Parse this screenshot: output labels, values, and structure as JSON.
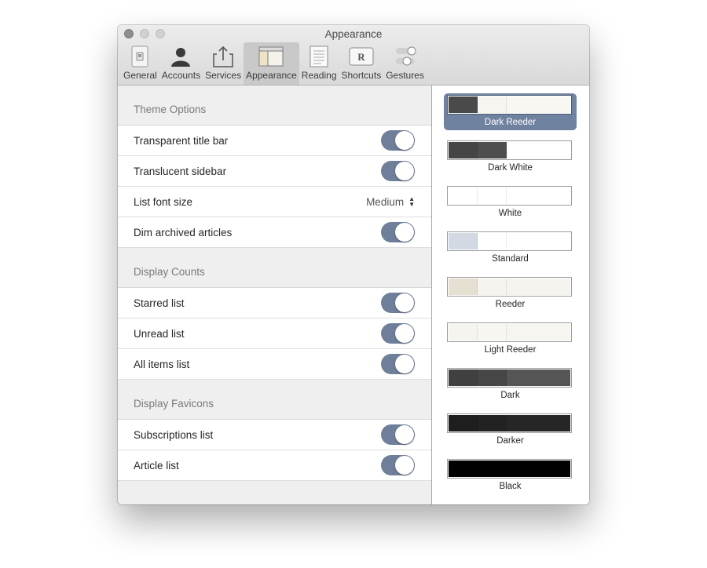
{
  "window": {
    "title": "Appearance"
  },
  "toolbar": {
    "items": [
      {
        "label": "General",
        "icon": "switch-icon"
      },
      {
        "label": "Accounts",
        "icon": "person-icon"
      },
      {
        "label": "Services",
        "icon": "share-icon"
      },
      {
        "label": "Appearance",
        "icon": "layout-icon",
        "active": true
      },
      {
        "label": "Reading",
        "icon": "document-icon"
      },
      {
        "label": "Shortcuts",
        "icon": "keyboard-key-icon",
        "key": "R"
      },
      {
        "label": "Gestures",
        "icon": "toggles-icon"
      }
    ]
  },
  "sections": {
    "theme_options": {
      "title": "Theme Options",
      "rows": [
        {
          "label": "Transparent title bar",
          "on": true
        },
        {
          "label": "Translucent sidebar",
          "on": true
        },
        {
          "label": "List font size",
          "value": "Medium"
        },
        {
          "label": "Dim archived articles",
          "on": true
        }
      ]
    },
    "display_counts": {
      "title": "Display Counts",
      "rows": [
        {
          "label": "Starred list",
          "on": true
        },
        {
          "label": "Unread list",
          "on": true
        },
        {
          "label": "All items list",
          "on": true
        }
      ]
    },
    "display_favicons": {
      "title": "Display Favicons",
      "rows": [
        {
          "label": "Subscriptions list",
          "on": true
        },
        {
          "label": "Article list",
          "on": true
        }
      ]
    }
  },
  "themes": [
    {
      "name": "Dark Reeder",
      "selected": true,
      "colors": [
        "#4a4a4a",
        "#f7f5f0",
        "#f9f7f2"
      ]
    },
    {
      "name": "Dark White",
      "colors": [
        "#454545",
        "#4e4e4e",
        "#ffffff"
      ]
    },
    {
      "name": "White",
      "colors": [
        "#ffffff",
        "#ffffff",
        "#ffffff"
      ]
    },
    {
      "name": "Standard",
      "colors": [
        "#d3d9e2",
        "#ffffff",
        "#ffffff"
      ]
    },
    {
      "name": "Reeder",
      "colors": [
        "#e5e0d2",
        "#f6f4ee",
        "#f6f4ee"
      ]
    },
    {
      "name": "Light Reeder",
      "colors": [
        "#f6f4ee",
        "#f8f6f0",
        "#f7f5ef"
      ]
    },
    {
      "name": "Dark",
      "colors": [
        "#404040",
        "#464646",
        "#555555"
      ]
    },
    {
      "name": "Darker",
      "colors": [
        "#1e1e1e",
        "#222222",
        "#262626"
      ]
    },
    {
      "name": "Black",
      "colors": [
        "#000000",
        "#000000",
        "#000000"
      ]
    }
  ],
  "colors": {
    "toggle_on": "#6f7f99",
    "selection": "#6f82a0"
  }
}
